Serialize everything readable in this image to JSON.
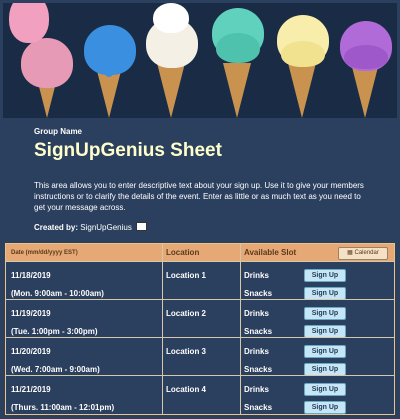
{
  "group_name": "Group Name",
  "sheet_title": "SignUpGenius Sheet",
  "description": "This area allows you to enter descriptive text about your sign up. Use it to give your members instructions or to clarify the details of the event. Enter as little or as much text as you need to get your message across.",
  "created_by_label": "Created by:",
  "created_by_name": "SignUpGenius",
  "table": {
    "headers": {
      "date": "Date (mm/dd/yyyy EST)",
      "location": "Location",
      "slot": "Available Slot",
      "calendar": "Calendar"
    },
    "rows": [
      {
        "date": "11/18/2019",
        "time": "(Mon. 9:00am - 10:00am)",
        "location": "Location 1",
        "slots": [
          "Drinks",
          "Snacks"
        ],
        "button": "Sign Up"
      },
      {
        "date": "11/19/2019",
        "time": "(Tue. 1:00pm - 3:00pm)",
        "location": "Location 2",
        "slots": [
          "Drinks",
          "Snacks"
        ],
        "button": "Sign Up"
      },
      {
        "date": "11/20/2019",
        "time": "(Wed. 7:00am - 9:00am)",
        "location": "Location 3",
        "slots": [
          "Drinks",
          "Snacks"
        ],
        "button": "Sign Up"
      },
      {
        "date": "11/21/2019",
        "time": "(Thurs. 11:00am - 12:01pm)",
        "location": "Location 4",
        "slots": [
          "Drinks",
          "Snacks"
        ],
        "button": "Sign Up"
      }
    ]
  },
  "colors": {
    "background": "#2b3f5e",
    "title": "#ffffcc",
    "header_bar": "#e6a874",
    "button": "#c6e6f5"
  },
  "icons": [
    "mail-icon",
    "calendar-icon"
  ]
}
